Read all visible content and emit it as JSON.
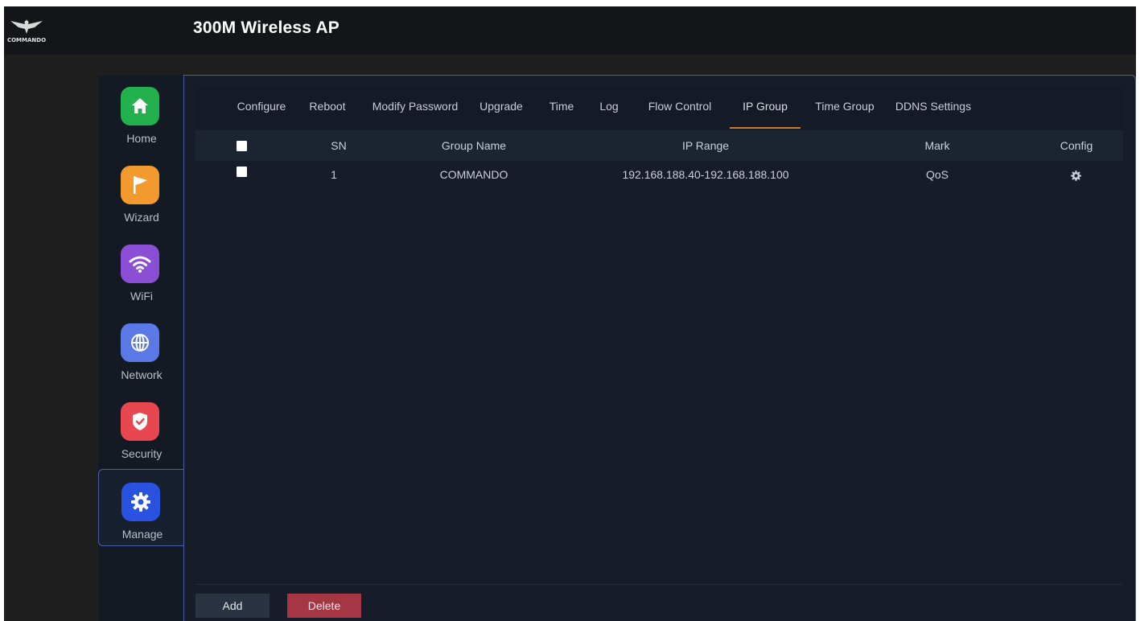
{
  "header": {
    "logo_icon": "commando-eagle-logo",
    "logo_text": "COMMANDO",
    "title": "300M Wireless AP"
  },
  "sidebar": {
    "items": [
      {
        "label": "Home",
        "icon": "home-icon",
        "color": "#22b14c"
      },
      {
        "label": "Wizard",
        "icon": "flag-icon",
        "color": "#f29a2e"
      },
      {
        "label": "WiFi",
        "icon": "wifi-icon",
        "color": "#8b4fd6"
      },
      {
        "label": "Network",
        "icon": "globe-icon",
        "color": "#5b79e6"
      },
      {
        "label": "Security",
        "icon": "shield-icon",
        "color": "#e8474f"
      },
      {
        "label": "Manage",
        "icon": "gear-icon",
        "color": "#2a52e0",
        "active": true
      }
    ]
  },
  "tabs": [
    {
      "label": "Configure"
    },
    {
      "label": "Reboot"
    },
    {
      "label": "Modify Password"
    },
    {
      "label": "Upgrade"
    },
    {
      "label": "Time"
    },
    {
      "label": "Log"
    },
    {
      "label": "Flow Control"
    },
    {
      "label": "IP Group",
      "active": true
    },
    {
      "label": "Time Group"
    },
    {
      "label": "DDNS Settings"
    }
  ],
  "table": {
    "columns": [
      "SN",
      "Group Name",
      "IP Range",
      "Mark",
      "Config"
    ],
    "rows": [
      {
        "sn": "1",
        "group_name": "COMMANDO",
        "ip_range": "192.168.188.40-192.168.188.100",
        "mark": "QoS",
        "config_icon": "gear-icon"
      }
    ]
  },
  "buttons": {
    "add": "Add",
    "delete": "Delete"
  },
  "colors": {
    "accent_tab": "#c97a35",
    "active_border": "#4a5fa8",
    "delete": "#a63643"
  }
}
